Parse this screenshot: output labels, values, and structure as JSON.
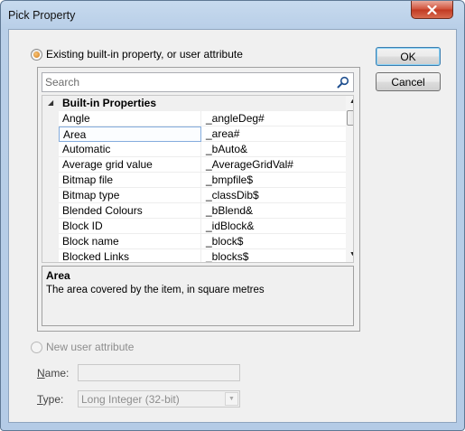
{
  "window": {
    "title": "Pick Property"
  },
  "options": {
    "existing_label": "Existing built-in property, or user attribute",
    "new_label": "New user attribute"
  },
  "buttons": {
    "ok": "OK",
    "cancel": "Cancel"
  },
  "search": {
    "placeholder": "Search"
  },
  "grid": {
    "category": "Built-in Properties",
    "selected_index": 1,
    "rows": [
      {
        "name": "Angle",
        "value": "_angleDeg#"
      },
      {
        "name": "Area",
        "value": "_area#"
      },
      {
        "name": "Automatic",
        "value": "_bAuto&"
      },
      {
        "name": "Average grid value",
        "value": "_AverageGridVal#"
      },
      {
        "name": "Bitmap file",
        "value": "_bmpfile$"
      },
      {
        "name": "Bitmap type",
        "value": "_classDib$"
      },
      {
        "name": "Blended Colours",
        "value": "_bBlend&"
      },
      {
        "name": "Block ID",
        "value": "_idBlock&"
      },
      {
        "name": "Block name",
        "value": "_block$"
      },
      {
        "name": "Blocked Links",
        "value": "_blocks$"
      }
    ]
  },
  "description": {
    "title": "Area",
    "text": "The area covered by the item, in square metres"
  },
  "new_attribute": {
    "name_label": "Name:",
    "name_value": "",
    "type_label": "Type:",
    "type_value": "Long Integer (32-bit)"
  },
  "colors": {
    "title_bar": "#b9cfe8",
    "dialog_face": "#f0f0f0",
    "close_button": "#c9452b",
    "disabled_text": "#8d8d8d"
  }
}
